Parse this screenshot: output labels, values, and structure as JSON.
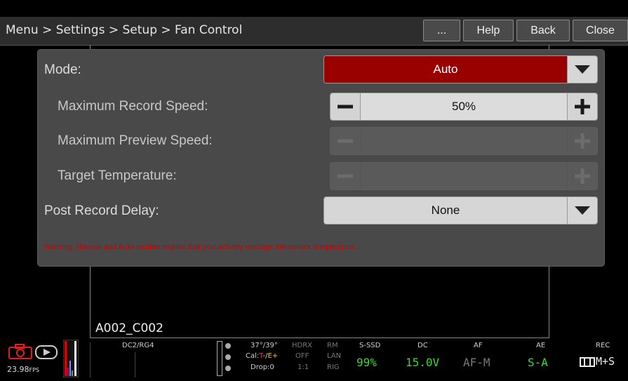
{
  "header": {
    "breadcrumb": "Menu > Settings > Setup > Fan Control",
    "buttons": {
      "more": "...",
      "help": "Help",
      "back": "Back",
      "close": "Close"
    }
  },
  "form": {
    "mode": {
      "label": "Mode:",
      "value": "Auto"
    },
    "max_record_speed": {
      "label": "Maximum Record Speed:",
      "value": "50%"
    },
    "max_preview_speed": {
      "label": "Maximum Preview Speed:",
      "value": ""
    },
    "target_temperature": {
      "label": "Target Temperature:",
      "value": ""
    },
    "post_record_delay": {
      "label": "Post Record Delay:",
      "value": "None"
    },
    "warning": "Warning: Manual and Auto modes require that you actively manage the sensor temperature."
  },
  "clip_name": "A002_C002",
  "statusbar": {
    "fps": "23.98",
    "fps_unit": "FPS",
    "codec": "DC2/RG4",
    "temp": "37°/39°",
    "cal_prefix": "Cal:",
    "cal_t": "T",
    "cal_sep": "-/",
    "cal_e": "E+",
    "drop": "Drop:0",
    "hdrx_label": "HDRX",
    "hdrx_val": "OFF",
    "ratio": "1:1",
    "rm_label": "RM",
    "rm_lan": "LAN",
    "rm_rig": "RIG",
    "media_label": "S-SSD",
    "media_val": "99%",
    "power_label": "DC",
    "power_val": "15.0V",
    "af_label": "AF",
    "af_val": "AF-M",
    "ae_label": "AE",
    "ae_val": "S-A",
    "rec_label": "REC",
    "rec_val": "M+S"
  },
  "colors": {
    "mode_red": "#990000",
    "green": "#33dd33",
    "warning_red": "#cc0000"
  }
}
